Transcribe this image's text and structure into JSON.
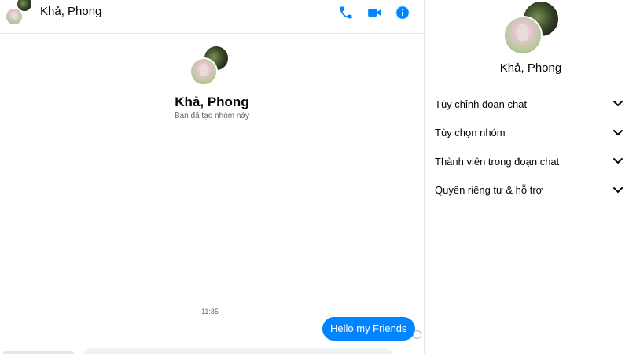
{
  "header": {
    "title": "Khả, Phong",
    "icons": [
      "phone-icon",
      "video-icon",
      "info-icon"
    ],
    "accent": "#0084ff"
  },
  "intro": {
    "title": "Khả, Phong",
    "subtitle": "Bạn đã tạo nhóm này"
  },
  "messages": {
    "timestamp": "11:35",
    "sent": "Hello my Friends"
  },
  "info_panel": {
    "name": "Khả, Phong",
    "menu": [
      {
        "label": "Tùy chỉnh đoạn chat"
      },
      {
        "label": "Tùy chọn nhóm"
      },
      {
        "label": "Thành viên trong đoạn chat"
      },
      {
        "label": "Quyền riêng tư & hỗ trợ"
      }
    ]
  }
}
